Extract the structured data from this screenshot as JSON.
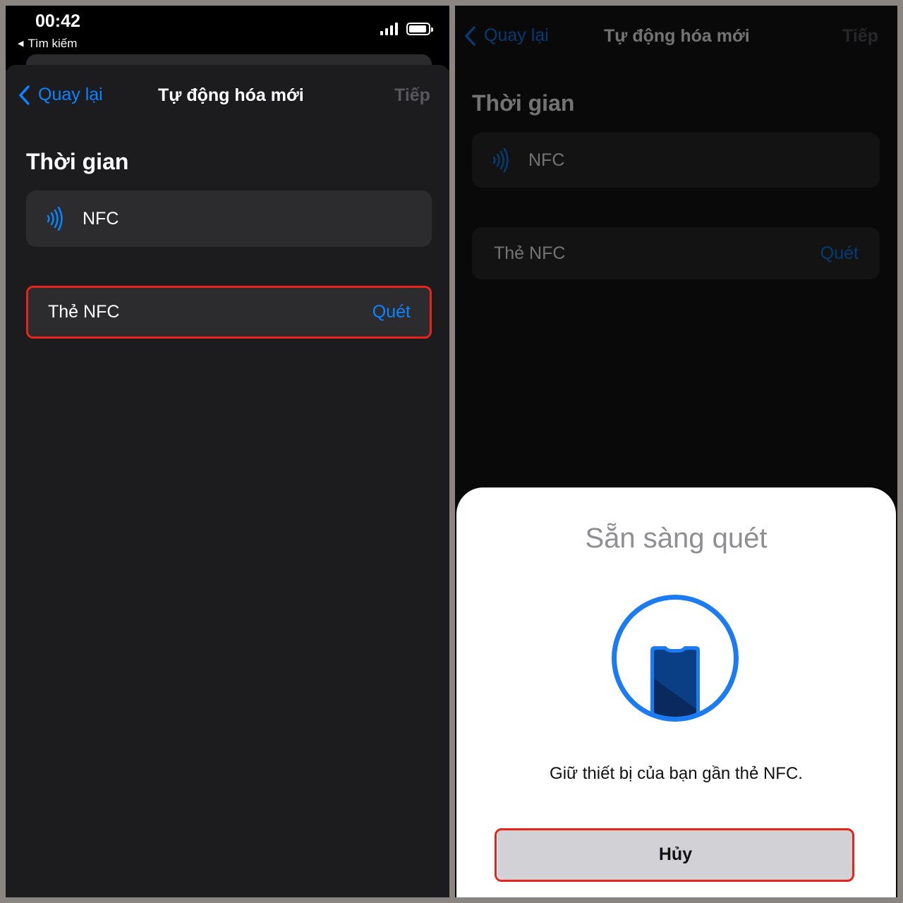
{
  "status_bar": {
    "time": "00:42",
    "back_app": "Tìm kiếm",
    "back_arrow_icon": "triangle-left-icon",
    "signal_icon": "cellular-signal-icon",
    "battery_icon": "battery-icon"
  },
  "nav": {
    "back_label": "Quay lại",
    "title": "Tự động hóa mới",
    "next_label": "Tiếp",
    "back_icon": "chevron-left-icon"
  },
  "section": {
    "title": "Thời gian"
  },
  "trigger": {
    "icon": "nfc-wave-icon",
    "label": "NFC"
  },
  "tag_row": {
    "label": "Thẻ NFC",
    "action": "Quét"
  },
  "scan_sheet": {
    "title": "Sẵn sàng quét",
    "icon": "phone-scan-icon",
    "message": "Giữ thiết bị của bạn gần thẻ NFC.",
    "cancel_label": "Hủy"
  },
  "colors": {
    "accent": "#0a84ff",
    "highlight": "#e8231a",
    "background": "#1c1c1e",
    "cell": "#2c2c2e"
  }
}
